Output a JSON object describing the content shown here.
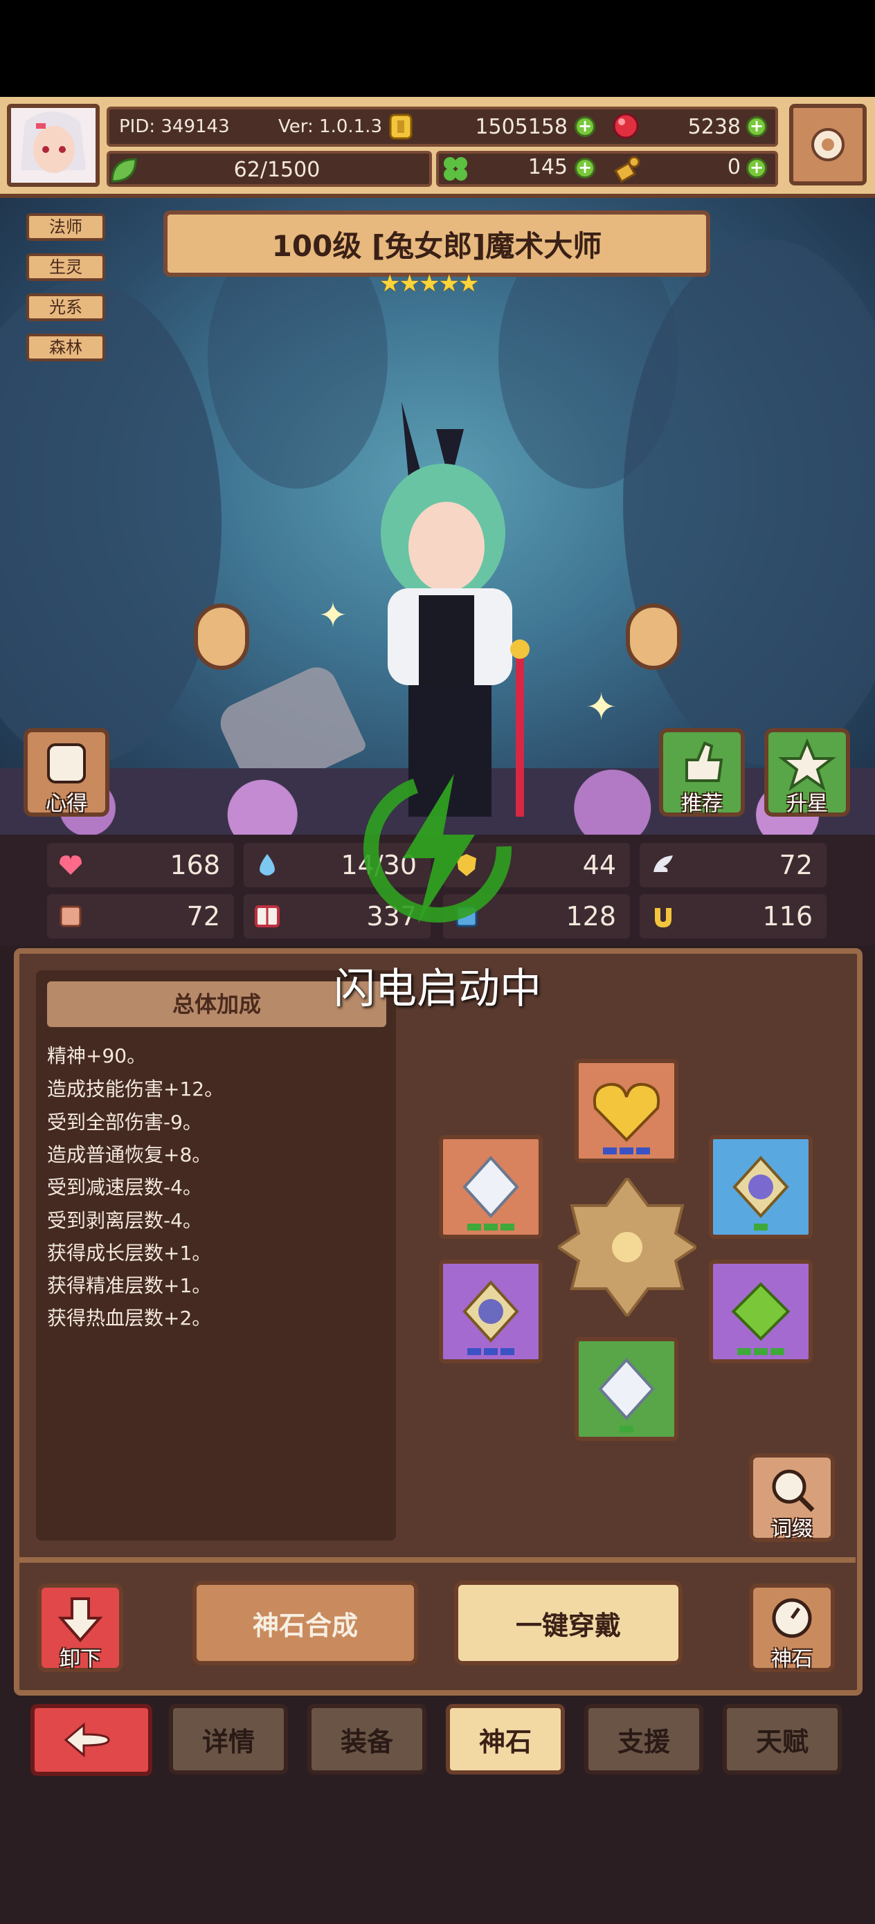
{
  "header": {
    "pid": "PID: 349143",
    "version": "Ver: 1.0.1.3",
    "gold": "1505158",
    "gems": "5238",
    "stamina": "62/1500",
    "clover": "145",
    "key": "0"
  },
  "tags": [
    "法师",
    "生灵",
    "光系",
    "森林"
  ],
  "hero": {
    "title": "100级 [兔女郎]魔术大师",
    "stars": 5
  },
  "scene_buttons": {
    "notes": "心得",
    "recommend": "推荐",
    "star_up": "升星"
  },
  "stats": {
    "hp": "168",
    "mana": "14/30",
    "attack": "44",
    "speed": "72",
    "defense": "72",
    "magic": "337",
    "spirit": "128",
    "luck": "116"
  },
  "overlay": "闪电启动中",
  "bonus_panel": {
    "title": "总体加成",
    "lines": [
      "精神+90。",
      "造成技能伤害+12。",
      "受到全部伤害-9。",
      "造成普通恢复+8。",
      "受到减速层数-4。",
      "受到剥离层数-4。",
      "获得成长层数+1。",
      "获得精准层数+1。",
      "获得热血层数+2。"
    ]
  },
  "affix_button": "词缀",
  "bottom_buttons": {
    "unequip": "卸下",
    "synthesize": "神石合成",
    "equip_all": "一键穿戴",
    "godstone": "神石"
  },
  "tabs": [
    "详情",
    "装备",
    "神石",
    "支援",
    "天赋"
  ],
  "active_tab": "神石",
  "colors": {
    "accent": "#e7b97f",
    "back_button": "#e0484a",
    "green_plus": "#78c83a",
    "lightning": "#2fa020"
  }
}
